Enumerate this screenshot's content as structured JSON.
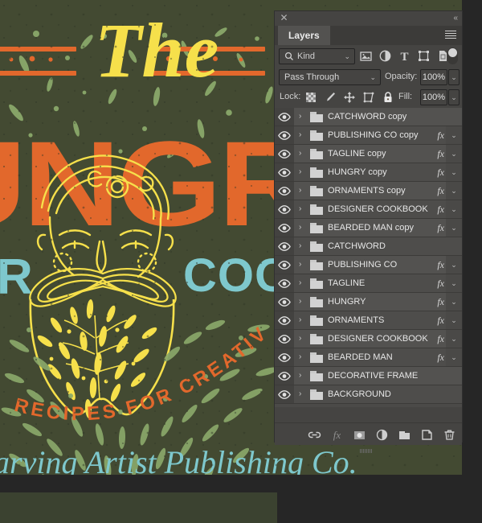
{
  "document_artwork": {
    "title_script": "The",
    "headline": "HUNGRY",
    "subtitle_left": "R",
    "subtitle_right": "COOKBO",
    "arc_text": "RECIPES FOR CREATIVE PEOPLE",
    "footer_script": "arving Artist Publishing Co.",
    "colors": {
      "background": "#434a32",
      "orange": "#e2682c",
      "yellow": "#f6e04b",
      "green_ornament": "#8aa86a",
      "light_blue": "#7ec8cd"
    }
  },
  "panel": {
    "close_icon": "close-icon",
    "collapse_icon": "collapse-arrows-icon",
    "tab_label": "Layers",
    "menu_icon": "panel-menu-icon"
  },
  "filter_bar": {
    "kind_label": "Kind",
    "search_icon": "search-icon",
    "chevron": "⌄",
    "icons": [
      {
        "name": "filter-pixel-layers-icon"
      },
      {
        "name": "filter-adjustment-layers-icon"
      },
      {
        "name": "filter-type-layers-icon"
      },
      {
        "name": "filter-shape-layers-icon"
      },
      {
        "name": "filter-smart-object-icon"
      }
    ],
    "toggle_name": "filter-enable-toggle"
  },
  "blend_row": {
    "blend_mode": "Pass Through",
    "opacity_label": "Opacity:",
    "opacity_value": "100%"
  },
  "lock_row": {
    "lock_label": "Lock:",
    "fill_label": "Fill:",
    "fill_value": "100%",
    "lock_icons": [
      {
        "name": "lock-transparent-pixels-icon"
      },
      {
        "name": "lock-image-pixels-icon"
      },
      {
        "name": "lock-position-icon"
      },
      {
        "name": "lock-artboard-nesting-icon"
      },
      {
        "name": "lock-all-icon"
      }
    ]
  },
  "layers": [
    {
      "name": "CATCHWORD copy",
      "visible": true,
      "fx": false
    },
    {
      "name": "PUBLISHING CO copy",
      "visible": true,
      "fx": true
    },
    {
      "name": "TAGLINE copy",
      "visible": true,
      "fx": true
    },
    {
      "name": "HUNGRY copy",
      "visible": true,
      "fx": true
    },
    {
      "name": "ORNAMENTS copy",
      "visible": true,
      "fx": true
    },
    {
      "name": "DESIGNER COOKBOOK ...",
      "visible": true,
      "fx": true
    },
    {
      "name": "BEARDED MAN copy",
      "visible": true,
      "fx": true
    },
    {
      "name": "CATCHWORD",
      "visible": true,
      "fx": false
    },
    {
      "name": "PUBLISHING CO",
      "visible": true,
      "fx": true
    },
    {
      "name": "TAGLINE",
      "visible": true,
      "fx": true
    },
    {
      "name": "HUNGRY",
      "visible": true,
      "fx": true
    },
    {
      "name": "ORNAMENTS",
      "visible": true,
      "fx": true
    },
    {
      "name": "DESIGNER COOKBOOK",
      "visible": true,
      "fx": true
    },
    {
      "name": "BEARDED MAN",
      "visible": true,
      "fx": true
    },
    {
      "name": "DECORATIVE FRAME",
      "visible": true,
      "fx": false
    },
    {
      "name": "BACKGROUND",
      "visible": true,
      "fx": false
    }
  ],
  "bottom_toolbar": [
    {
      "name": "link-layers-icon"
    },
    {
      "name": "layer-style-fx-icon"
    },
    {
      "name": "add-layer-mask-icon"
    },
    {
      "name": "new-adjustment-layer-icon"
    },
    {
      "name": "new-group-icon"
    },
    {
      "name": "new-layer-icon"
    },
    {
      "name": "delete-layer-icon"
    }
  ]
}
